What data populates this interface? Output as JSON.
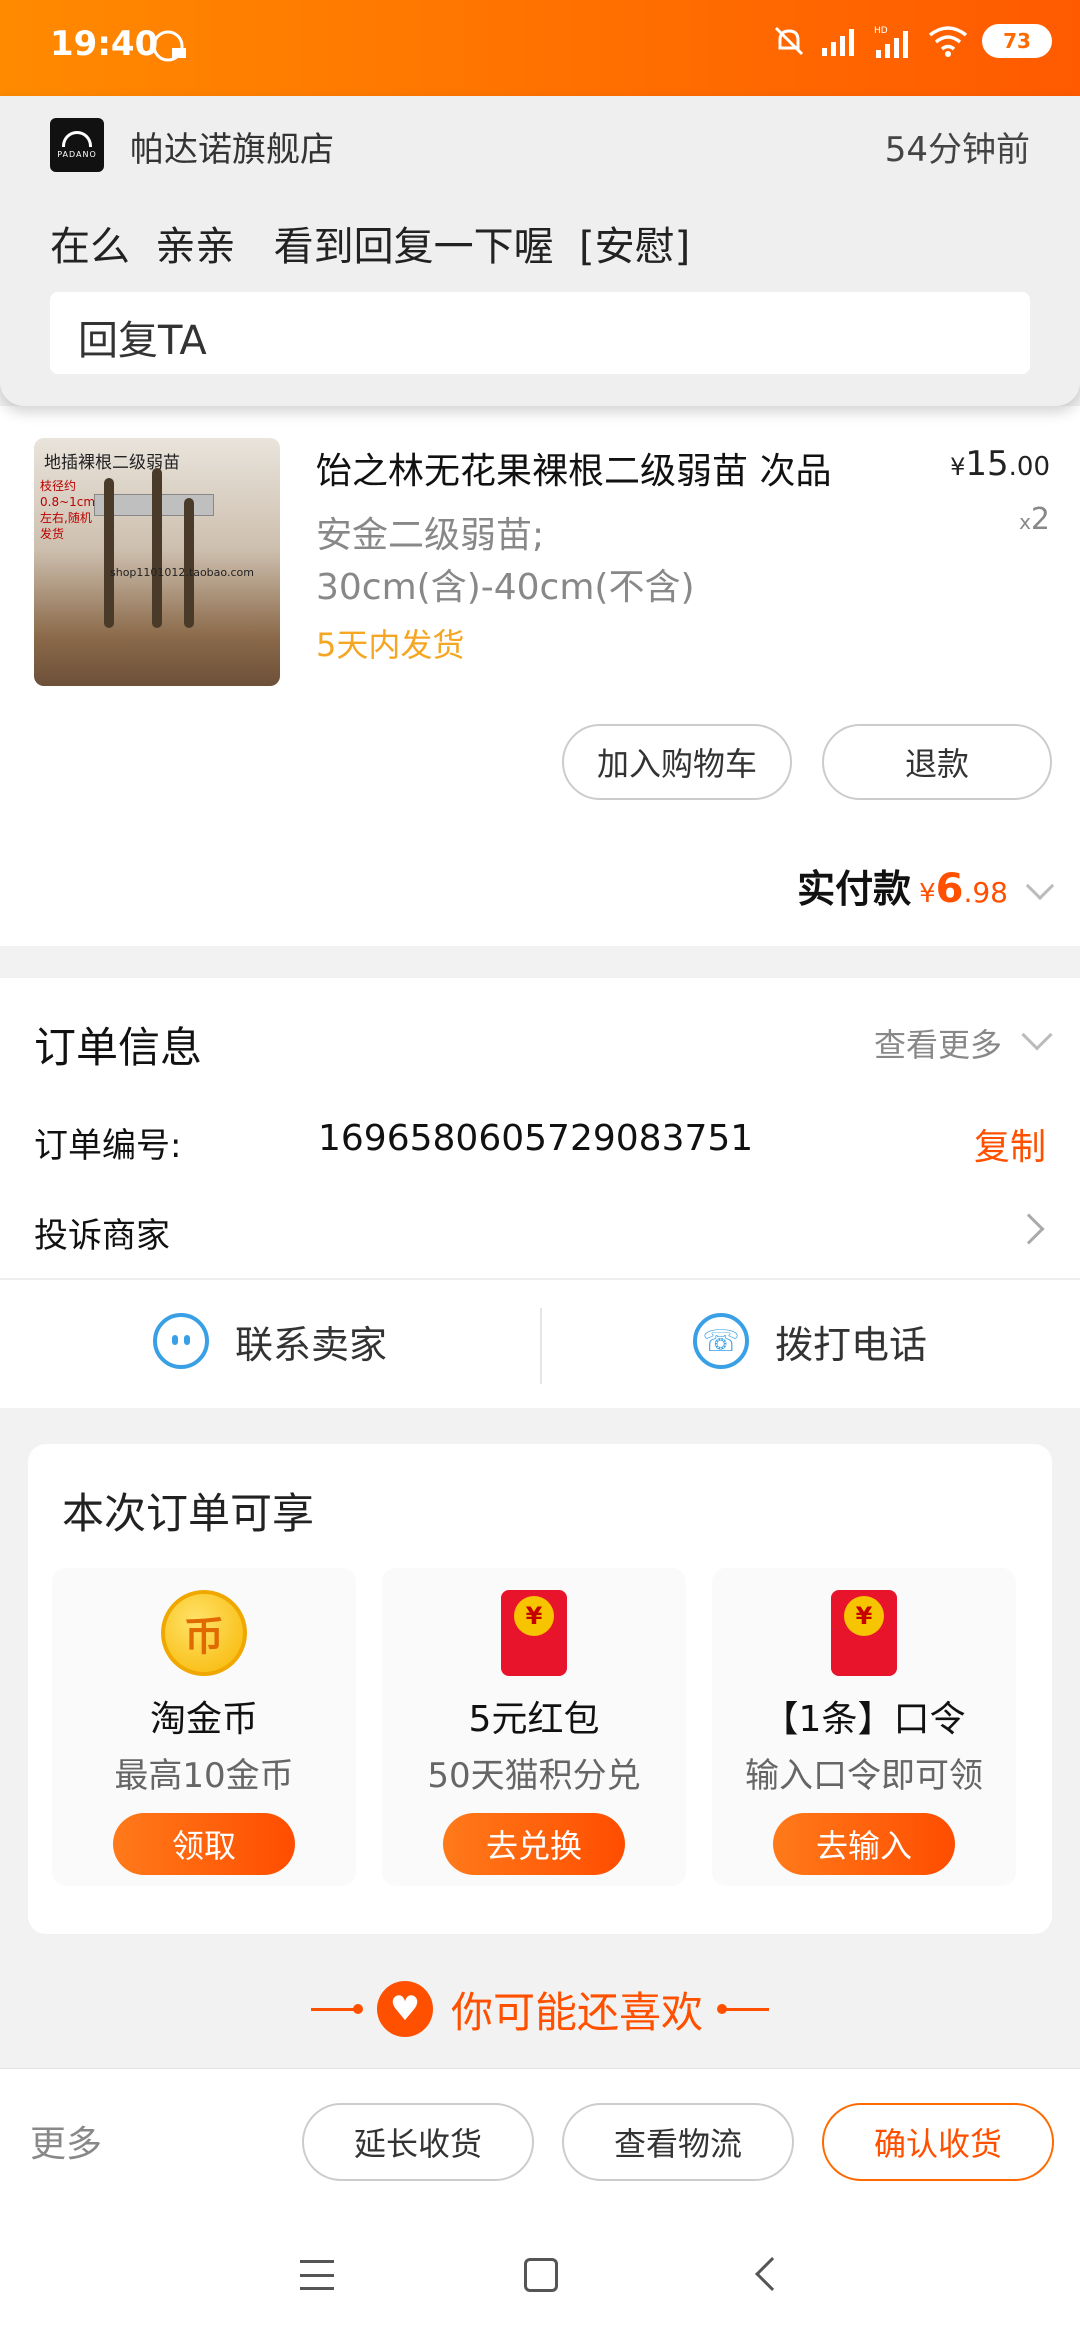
{
  "status_bar": {
    "time": "19:40",
    "battery": "73",
    "icons": [
      "mute-icon",
      "signal-icon",
      "hd-signal-icon",
      "wifi-icon",
      "battery-icon"
    ]
  },
  "notification": {
    "app_name": "帕达诺旗舰店",
    "logo_text": "PADANO",
    "time_ago": "54分钟前",
    "message": "在么  亲亲   看到回复一下喔  [安慰]",
    "reply_placeholder": "回复TA"
  },
  "product": {
    "title": "饴之林无花果裸根二级弱苗 次品",
    "spec_line1": "安金二级弱苗;",
    "spec_line2": "30cm(含)-40cm(不含)",
    "shipping": "5天内发货",
    "price_currency": "¥",
    "price_int": "15",
    "price_dec": ".00",
    "qty_prefix": "x",
    "qty": "2",
    "image_caption": "地插裸根二级弱苗",
    "image_caption2": "枝径约0.8~1cm 左右,随机发货",
    "image_url": "shop1101012.taobao.com",
    "add_cart_label": "加入购物车",
    "refund_label": "退款",
    "paid_label": "实付款",
    "paid_currency": "¥",
    "paid_int": "6",
    "paid_dec": ".98"
  },
  "order_info": {
    "title": "订单信息",
    "view_more": "查看更多",
    "order_no_label": "订单编号:",
    "order_no": "1696580605729083751",
    "copy_label": "复制",
    "complain_label": "投诉商家",
    "contact_seller": "联系卖家",
    "call_phone": "拨打电话"
  },
  "benefits": {
    "title": "本次订单可享",
    "items": [
      {
        "name": "淘金币",
        "desc": "最高10金币",
        "button": "领取",
        "icon": "coin-icon"
      },
      {
        "name": "5元红包",
        "desc": "50天猫积分兑",
        "button": "去兑换",
        "icon": "red-packet-icon"
      },
      {
        "name": "【1条】口令",
        "desc": "输入口令即可领",
        "button": "去输入",
        "icon": "red-packet-icon"
      }
    ]
  },
  "recommend": {
    "title": "你可能还喜欢"
  },
  "action_bar": {
    "more": "更多",
    "extend": "延长收货",
    "logistics": "查看物流",
    "confirm": "确认收货"
  },
  "colors": {
    "accent": "#ff5000",
    "status_bar": "#ff6a00",
    "link_blue": "#3aa0e6",
    "shipping_text": "#f5a623"
  }
}
